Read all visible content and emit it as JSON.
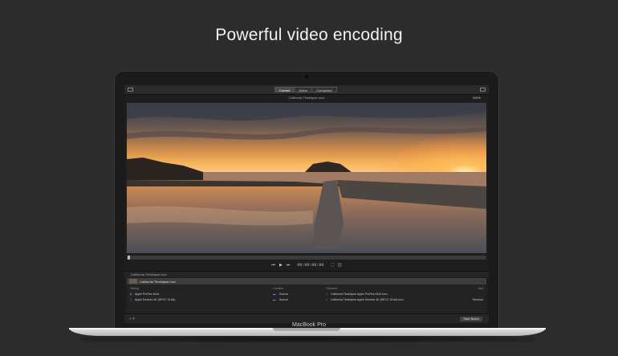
{
  "headline": "Powerful video encoding",
  "laptop": {
    "brand": "MacBook Pro"
  },
  "app": {
    "segments": [
      {
        "label": "Current",
        "active": true
      },
      {
        "label": "Active",
        "active": false
      },
      {
        "label": "Completed",
        "active": false
      }
    ],
    "file_title": "California Timelapse.mov",
    "zoom": "100%",
    "timecode": "00:00:00:00",
    "source_bar": "California Timelapse.mov",
    "batch_item": "California Timelapse.mov",
    "columns": {
      "setting": "Setting",
      "location": "Location",
      "filename": "Filename"
    },
    "add_label": "Add",
    "rows": [
      {
        "setting": "Apple ProRes 4444",
        "location": "Source",
        "filename": "California Timelapse-Apple ProRes 4444.mov"
      },
      {
        "setting": "Apple Devices 4K (HEVC 10-bit)",
        "location": "Source",
        "filename": "California Timelapse-Apple Devices 4K (HEVC 10-bit).mov",
        "action": "Remove"
      }
    ],
    "start_batch": "Start Batch",
    "icons": [
      "sidebar-icon",
      "share-icon",
      "skip-back-icon",
      "play-icon",
      "skip-forward-icon",
      "fullscreen-icon",
      "audio-icon",
      "add-icon"
    ]
  }
}
